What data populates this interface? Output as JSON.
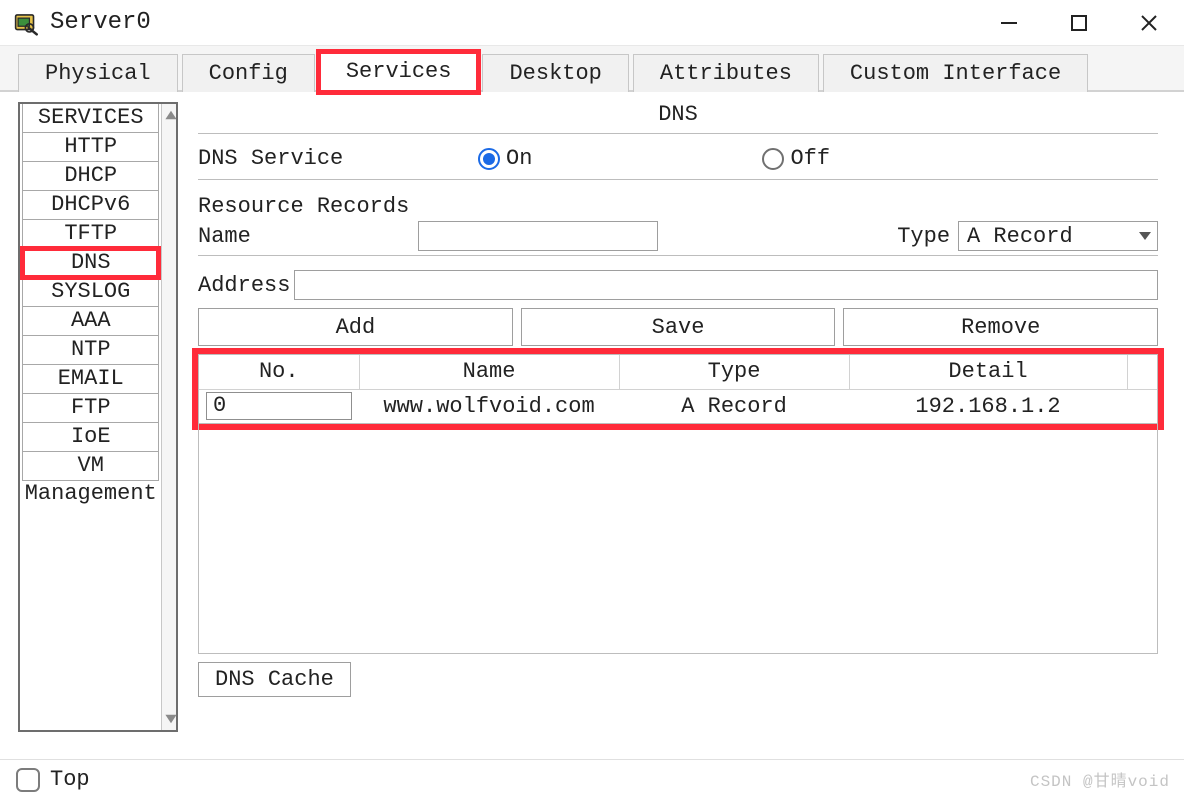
{
  "window": {
    "title": "Server0"
  },
  "tabs": {
    "physical": "Physical",
    "config": "Config",
    "services": "Services",
    "desktop": "Desktop",
    "attributes": "Attributes",
    "custom": "Custom Interface",
    "active": "services"
  },
  "sidebar": {
    "items": [
      "SERVICES",
      "HTTP",
      "DHCP",
      "DHCPv6",
      "TFTP",
      "DNS",
      "SYSLOG",
      "AAA",
      "NTP",
      "EMAIL",
      "FTP",
      "IoE",
      "VM Management"
    ],
    "selected": "DNS"
  },
  "panel": {
    "title": "DNS",
    "service_label": "DNS Service",
    "on_label": "On",
    "off_label": "Off",
    "service_state": "on",
    "resource_records_title": "Resource Records",
    "name_label": "Name",
    "name_value": "",
    "type_label": "Type",
    "type_selected": "A Record",
    "type_options": [
      "A Record"
    ],
    "address_label": "Address",
    "address_value": "",
    "buttons": {
      "add": "Add",
      "save": "Save",
      "remove": "Remove"
    },
    "table": {
      "columns": [
        "No.",
        "Name",
        "Type",
        "Detail"
      ],
      "rows": [
        {
          "no": "0",
          "name": "www.wolfvoid.com",
          "type": "A Record",
          "detail": "192.168.1.2"
        }
      ]
    },
    "dns_cache_button": "DNS Cache"
  },
  "footer": {
    "top_label": "Top",
    "top_checked": false
  },
  "watermark": "CSDN @甘晴void"
}
